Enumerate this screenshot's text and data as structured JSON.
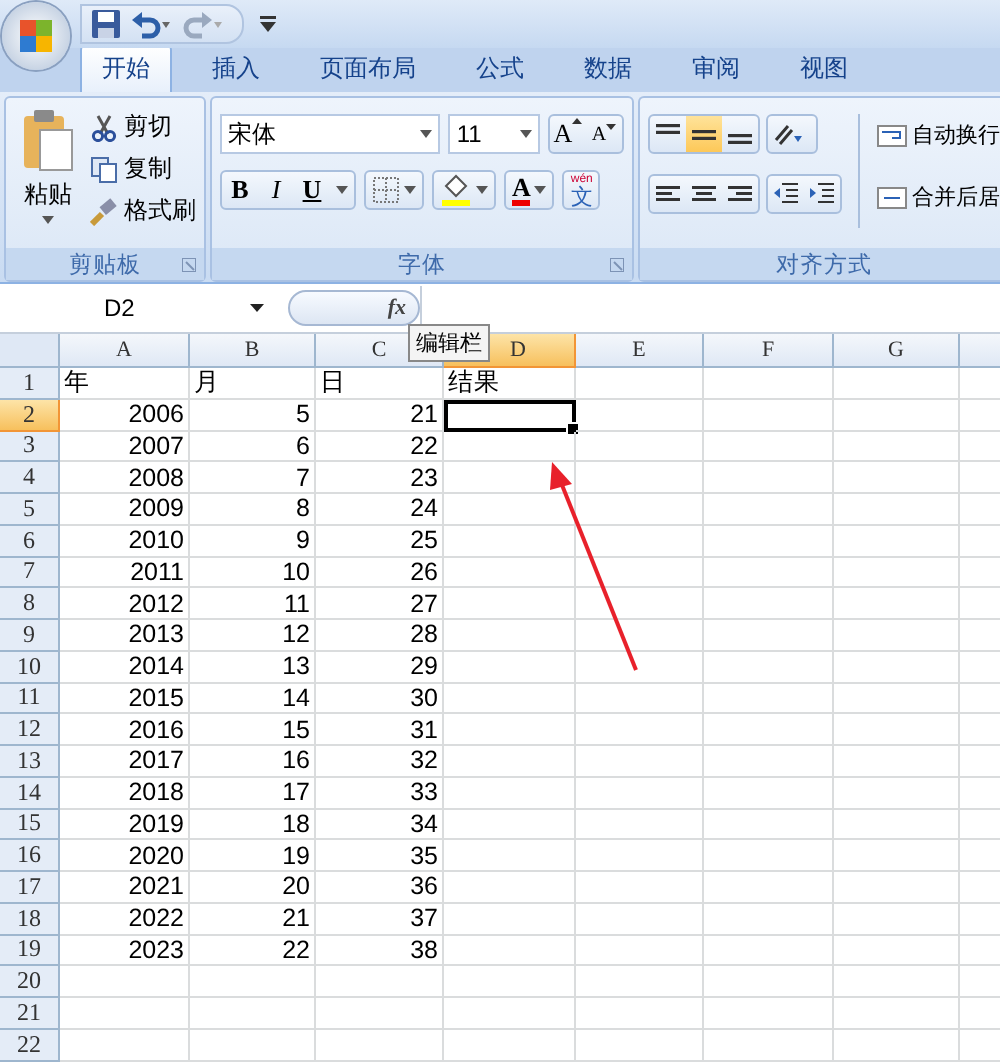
{
  "tabs": [
    {
      "label": "开始",
      "selected": true
    },
    {
      "label": "插入",
      "selected": false
    },
    {
      "label": "页面布局",
      "selected": false
    },
    {
      "label": "公式",
      "selected": false
    },
    {
      "label": "数据",
      "selected": false
    },
    {
      "label": "审阅",
      "selected": false
    },
    {
      "label": "视图",
      "selected": false
    }
  ],
  "clipboard": {
    "label": "剪贴板",
    "paste": "粘贴",
    "cut": "剪切",
    "copy": "复制",
    "format_painter": "格式刷"
  },
  "font": {
    "label": "字体",
    "font_name": "宋体",
    "font_size": "11",
    "grow": "A",
    "shrink": "A",
    "bold": "B",
    "italic": "I",
    "underline": "U",
    "font_color": "A",
    "phonetic_top": "wén",
    "phonetic": "文"
  },
  "alignment": {
    "label": "对齐方式",
    "vertical": [
      {
        "kind": "top",
        "selected": false
      },
      {
        "kind": "middle",
        "selected": true
      },
      {
        "kind": "bottom",
        "selected": false
      }
    ],
    "wrap_text": "自动换行",
    "merge_center": "合并后居"
  },
  "formula_bar": {
    "name_box": "D2",
    "fx": "fx",
    "tooltip": "编辑栏"
  },
  "columns": [
    {
      "label": "A",
      "selected": false
    },
    {
      "label": "B",
      "selected": false
    },
    {
      "label": "C",
      "selected": false
    },
    {
      "label": "D",
      "selected": true
    },
    {
      "label": "E",
      "selected": false
    },
    {
      "label": "F",
      "selected": false
    },
    {
      "label": "G",
      "selected": false
    }
  ],
  "rows": [
    {
      "header": "1",
      "kind": "text",
      "selected": false,
      "cells": [
        "年",
        "月",
        "日",
        "结果"
      ]
    },
    {
      "header": "2",
      "kind": "number",
      "selected": true,
      "cells": [
        "2006",
        "5",
        "21"
      ]
    },
    {
      "header": "3",
      "kind": "number",
      "selected": false,
      "cells": [
        "2007",
        "6",
        "22"
      ]
    },
    {
      "header": "4",
      "kind": "number",
      "selected": false,
      "cells": [
        "2008",
        "7",
        "23"
      ]
    },
    {
      "header": "5",
      "kind": "number",
      "selected": false,
      "cells": [
        "2009",
        "8",
        "24"
      ]
    },
    {
      "header": "6",
      "kind": "number",
      "selected": false,
      "cells": [
        "2010",
        "9",
        "25"
      ]
    },
    {
      "header": "7",
      "kind": "number",
      "selected": false,
      "cells": [
        "2011",
        "10",
        "26"
      ]
    },
    {
      "header": "8",
      "kind": "number",
      "selected": false,
      "cells": [
        "2012",
        "11",
        "27"
      ]
    },
    {
      "header": "9",
      "kind": "number",
      "selected": false,
      "cells": [
        "2013",
        "12",
        "28"
      ]
    },
    {
      "header": "10",
      "kind": "number",
      "selected": false,
      "cells": [
        "2014",
        "13",
        "29"
      ]
    },
    {
      "header": "11",
      "kind": "number",
      "selected": false,
      "cells": [
        "2015",
        "14",
        "30"
      ]
    },
    {
      "header": "12",
      "kind": "number",
      "selected": false,
      "cells": [
        "2016",
        "15",
        "31"
      ]
    },
    {
      "header": "13",
      "kind": "number",
      "selected": false,
      "cells": [
        "2017",
        "16",
        "32"
      ]
    },
    {
      "header": "14",
      "kind": "number",
      "selected": false,
      "cells": [
        "2018",
        "17",
        "33"
      ]
    },
    {
      "header": "15",
      "kind": "number",
      "selected": false,
      "cells": [
        "2019",
        "18",
        "34"
      ]
    },
    {
      "header": "16",
      "kind": "number",
      "selected": false,
      "cells": [
        "2020",
        "19",
        "35"
      ]
    },
    {
      "header": "17",
      "kind": "number",
      "selected": false,
      "cells": [
        "2021",
        "20",
        "36"
      ]
    },
    {
      "header": "18",
      "kind": "number",
      "selected": false,
      "cells": [
        "2022",
        "21",
        "37"
      ]
    },
    {
      "header": "19",
      "kind": "number",
      "selected": false,
      "cells": [
        "2023",
        "22",
        "38"
      ]
    },
    {
      "header": "20",
      "kind": "number",
      "selected": false,
      "cells": []
    },
    {
      "header": "21",
      "kind": "number",
      "selected": false,
      "cells": []
    },
    {
      "header": "22",
      "kind": "number",
      "selected": false,
      "cells": []
    }
  ]
}
